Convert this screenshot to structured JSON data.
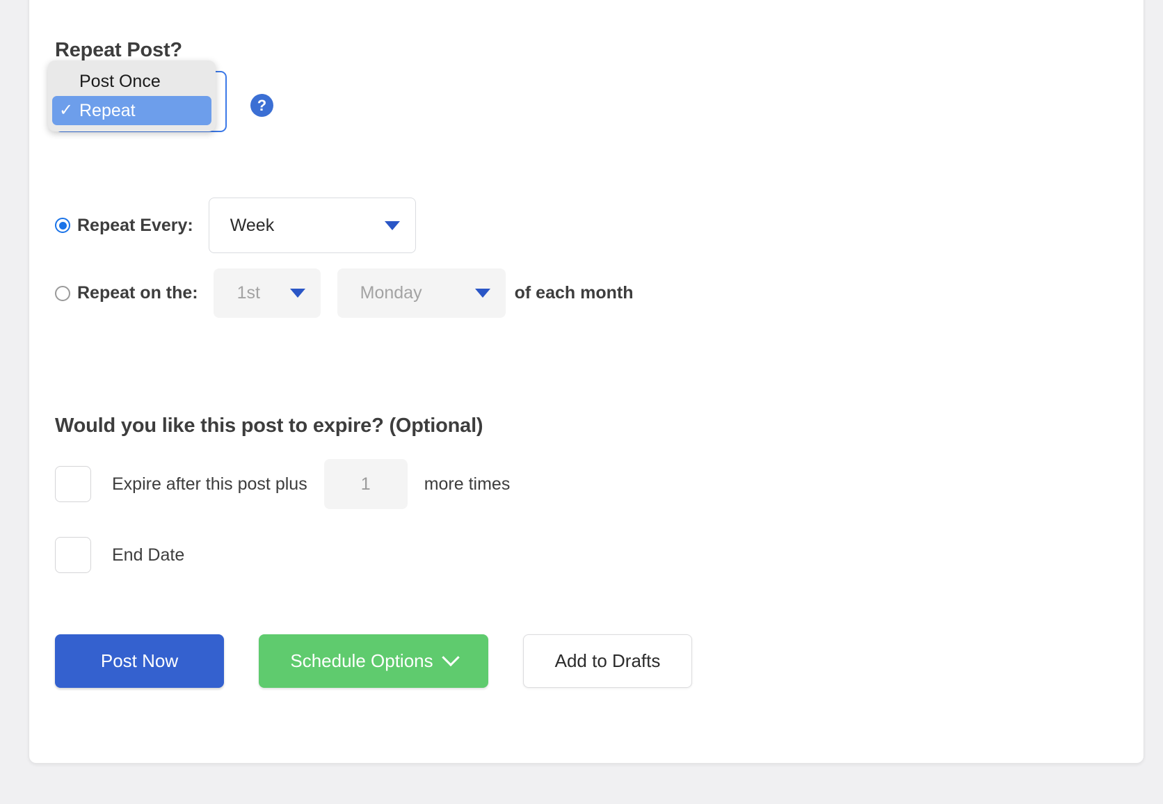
{
  "card": {
    "repeat_post_title": "Repeat Post?",
    "expire_title": "Would you like this post to expire? (Optional)"
  },
  "repeat_select": {
    "selected_value": "Repeat",
    "open": true,
    "options": [
      {
        "label": "Post Once",
        "checked": false,
        "check_glyph": ""
      },
      {
        "label": "Repeat",
        "checked": true,
        "check_glyph": "✓"
      }
    ],
    "highlight_color": "#6d9eeb",
    "focus_border_color": "#3b78e7"
  },
  "help": {
    "icon": "question-mark-icon",
    "glyph": "?",
    "color": "#3b6fd4"
  },
  "repeat_every": {
    "radio_selected": true,
    "label": "Repeat Every:",
    "interval_value": "Week",
    "caret": "chevron-down-icon"
  },
  "repeat_on_the": {
    "radio_selected": false,
    "label": "Repeat on the:",
    "ordinal_value": "1st",
    "weekday_value": "Monday",
    "suffix": "of each month",
    "disabled": true
  },
  "expire": {
    "expire_times_row": {
      "checked": false,
      "label_before": "Expire after this post plus",
      "count_value": "1",
      "label_after": "more times"
    },
    "end_date_row": {
      "checked": false,
      "label": "End Date"
    }
  },
  "footer": {
    "post_now_label": "Post Now",
    "schedule_options_label": "Schedule Options",
    "schedule_options_caret": "chevron-down-icon",
    "add_to_drafts_label": "Add to Drafts",
    "post_now_color": "#3461cf",
    "schedule_options_color": "#5fcb6e"
  }
}
